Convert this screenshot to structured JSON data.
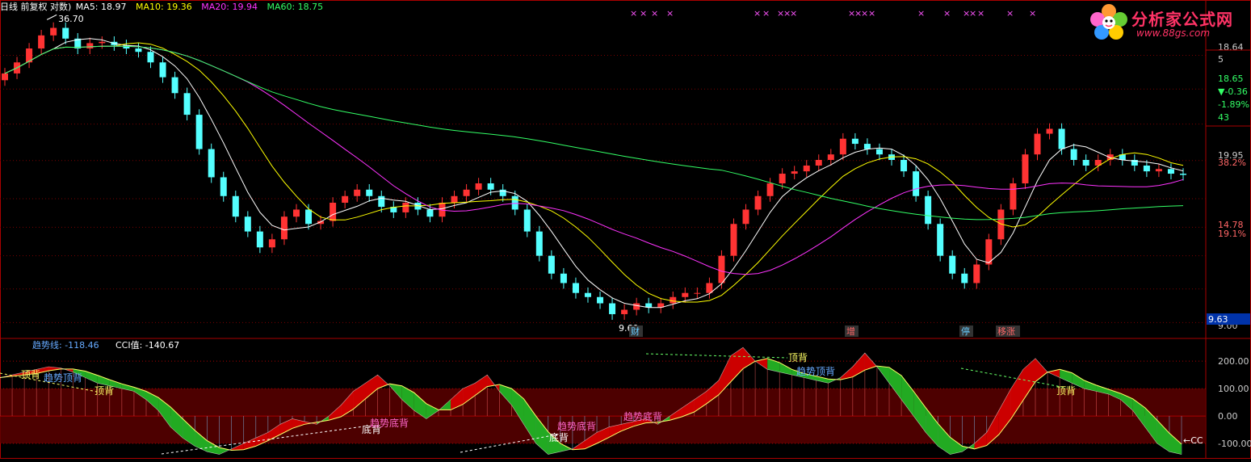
{
  "header": {
    "period_label": "日线 前复权 对数)",
    "ma": [
      {
        "label": "MA5: 18.97",
        "color": "#ffffff"
      },
      {
        "label": "MA10: 19.36",
        "color": "#ffff00"
      },
      {
        "label": "MA20: 19.94",
        "color": "#ff33ff"
      },
      {
        "label": "MA60: 18.75",
        "color": "#33ff66"
      }
    ]
  },
  "logo": {
    "text": "分析家公式网",
    "url": "www.88gs.com",
    "color": "#ff3366"
  },
  "price_axis": {
    "ticks": [
      "18.64",
      "5",
      "18.65",
      "▼-0.36",
      "-1.89%",
      "43",
      "19.95",
      "38.2%",
      "14.78",
      "19.1%",
      "9.63",
      "9.00"
    ],
    "tick_colors": [
      "#cccccc",
      "#cccccc",
      "#33ff66",
      "#33ff66",
      "#33ff66",
      "#33ff66",
      "#cccccc",
      "#ff6666",
      "#ff6666",
      "#ff6666",
      "#ffffff",
      "#cccccc"
    ]
  },
  "annotations": {
    "high_label": "36.70",
    "low_label": "9.60",
    "event_tags": [
      "财",
      "增",
      "停",
      "移涨"
    ],
    "marker_char": "×"
  },
  "indicator": {
    "trend_label": "趋势线: -118.46",
    "cci_label": "CCI值: -140.67",
    "axis_ticks": [
      "200.00",
      "100.00",
      "0.00",
      "-100.00"
    ],
    "signals": [
      "顶背",
      "趋势顶背",
      "顶背",
      "底背",
      "趋势底背",
      "底背",
      "趋势底背",
      "趋势底背",
      "顶背",
      "趋势顶背",
      "顶背"
    ],
    "cci_tag": "←CC"
  },
  "chart_data": [
    {
      "type": "candlestick",
      "title": "",
      "yscale": "log",
      "ylim": [
        9.0,
        39.0
      ],
      "series": [
        {
          "name": "MA5",
          "color": "#ffffff"
        },
        {
          "name": "MA10",
          "color": "#ffff00"
        },
        {
          "name": "MA20",
          "color": "#ff33ff"
        },
        {
          "name": "MA60",
          "color": "#33ff66"
        }
      ],
      "close_approx": [
        29.5,
        31,
        33,
        35,
        36.2,
        34.5,
        33,
        33.8,
        34,
        33.5,
        33,
        32.5,
        31,
        29,
        27,
        24.5,
        21,
        18.5,
        17,
        15.5,
        14.5,
        13.5,
        14,
        15.5,
        16,
        15,
        15.2,
        16.5,
        17,
        17.5,
        17,
        16.2,
        15.8,
        16.5,
        16,
        15.5,
        16.5,
        17,
        17.5,
        18,
        17.5,
        17,
        16,
        14.5,
        13,
        12,
        11.5,
        11,
        10.8,
        10.5,
        10,
        10.2,
        10.5,
        10.3,
        10.5,
        10.8,
        11,
        11,
        11.5,
        13,
        15,
        16,
        17,
        18,
        18.8,
        19,
        19.5,
        20,
        20.5,
        22,
        21.5,
        21,
        20.5,
        20,
        19,
        17,
        15,
        13,
        12,
        11.5,
        12.5,
        14,
        16,
        18,
        20.5,
        22.5,
        23,
        21,
        20,
        19.5,
        20,
        20.5,
        20,
        19.5,
        19,
        19.2,
        18.8,
        18.7
      ],
      "high_label": 36.7,
      "low_label": 9.6,
      "last": {
        "ma5": 18.97,
        "ma10": 19.36,
        "ma20": 19.94,
        "ma60": 18.75
      }
    },
    {
      "type": "line",
      "title": "",
      "ylim": [
        -150,
        280
      ],
      "series": [
        {
          "name": "趋势线",
          "last": -118.46,
          "color": "#ffff66"
        },
        {
          "name": "CCI值",
          "last": -140.67,
          "color": "#ffffff"
        }
      ],
      "cci_approx": [
        140,
        150,
        160,
        170,
        180,
        175,
        160,
        140,
        120,
        110,
        100,
        90,
        60,
        20,
        -40,
        -80,
        -110,
        -130,
        -140,
        -120,
        -100,
        -80,
        -60,
        -30,
        -10,
        -20,
        -30,
        0,
        40,
        90,
        120,
        150,
        110,
        60,
        20,
        -10,
        20,
        60,
        100,
        120,
        150,
        90,
        40,
        -30,
        -100,
        -140,
        -130,
        -120,
        -90,
        -60,
        -40,
        -30,
        -20,
        -10,
        -30,
        0,
        30,
        60,
        90,
        130,
        220,
        250,
        200,
        170,
        160,
        150,
        140,
        130,
        120,
        140,
        180,
        230,
        180,
        120,
        60,
        0,
        -60,
        -110,
        -140,
        -130,
        -100,
        -60,
        20,
        100,
        170,
        210,
        160,
        140,
        120,
        100,
        90,
        80,
        60,
        20,
        -40,
        -100,
        -130,
        -140
      ]
    }
  ]
}
